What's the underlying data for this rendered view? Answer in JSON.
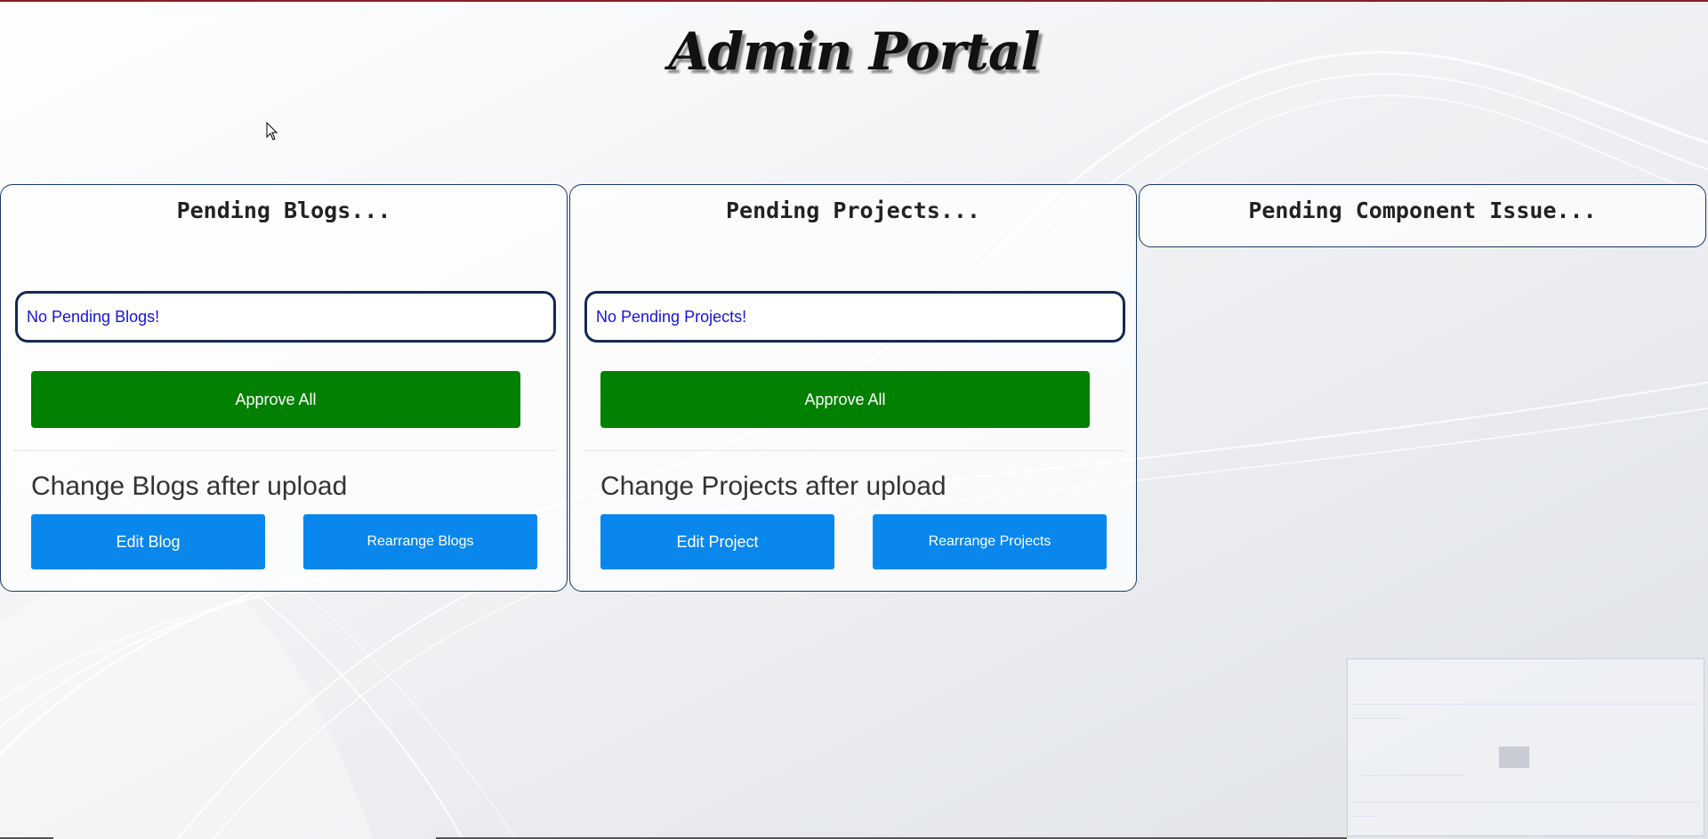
{
  "page": {
    "title": "Admin Portal"
  },
  "panels": [
    {
      "title": "Pending Blogs...",
      "notice": "No Pending Blogs!",
      "approve_label": "Approve All",
      "change_heading": "Change Blogs after upload",
      "edit_label": "Edit Blog",
      "rearrange_label": "Rearrange Blogs"
    },
    {
      "title": "Pending Projects...",
      "notice": "No Pending Projects!",
      "approve_label": "Approve All",
      "change_heading": "Change Projects after upload",
      "edit_label": "Edit Project",
      "rearrange_label": "Rearrange Projects"
    },
    {
      "title": "Pending Component Issue..."
    }
  ],
  "colors": {
    "approve_green": "#018001",
    "action_blue": "#0987ec",
    "notice_text": "#1414d8",
    "panel_border": "#163a67",
    "top_accent": "#8b1d25"
  },
  "icons": {
    "cursor": "mouse-pointer-icon"
  }
}
